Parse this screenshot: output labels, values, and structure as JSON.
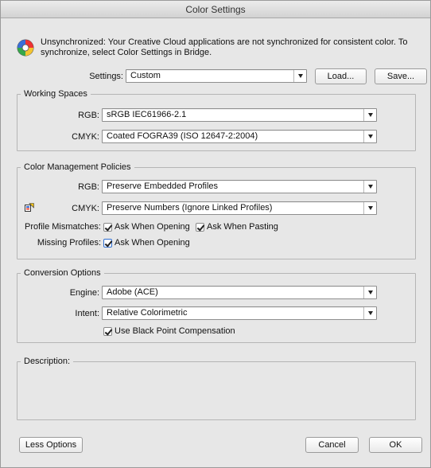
{
  "window": {
    "title": "Color Settings"
  },
  "sync": {
    "icon": "creative-cloud-sync-icon",
    "message": "Unsynchronized: Your Creative Cloud applications are not synchronized for consistent color. To synchronize, select Color Settings in Bridge."
  },
  "settings": {
    "label": "Settings:",
    "value": "Custom",
    "load_label": "Load...",
    "save_label": "Save..."
  },
  "working_spaces": {
    "title": "Working Spaces",
    "rgb_label": "RGB:",
    "rgb_value": "sRGB IEC61966-2.1",
    "cmyk_label": "CMYK:",
    "cmyk_value": "Coated FOGRA39 (ISO 12647-2:2004)"
  },
  "policies": {
    "title": "Color Management Policies",
    "rgb_label": "RGB:",
    "rgb_value": "Preserve Embedded Profiles",
    "cmyk_label": "CMYK:",
    "cmyk_value": "Preserve Numbers (Ignore Linked Profiles)",
    "warning_icon": "policy-warning-icon",
    "mismatch_label": "Profile Mismatches:",
    "ask_opening_label": "Ask When Opening",
    "ask_opening_checked": true,
    "ask_pasting_label": "Ask When Pasting",
    "ask_pasting_checked": true,
    "missing_label": "Missing Profiles:",
    "missing_ask_label": "Ask When Opening",
    "missing_ask_checked": true
  },
  "conversion": {
    "title": "Conversion Options",
    "engine_label": "Engine:",
    "engine_value": "Adobe (ACE)",
    "intent_label": "Intent:",
    "intent_value": "Relative Colorimetric",
    "bpc_label": "Use Black Point Compensation",
    "bpc_checked": true
  },
  "description": {
    "title": "Description:"
  },
  "footer": {
    "less_options_label": "Less Options",
    "cancel_label": "Cancel",
    "ok_label": "OK"
  }
}
